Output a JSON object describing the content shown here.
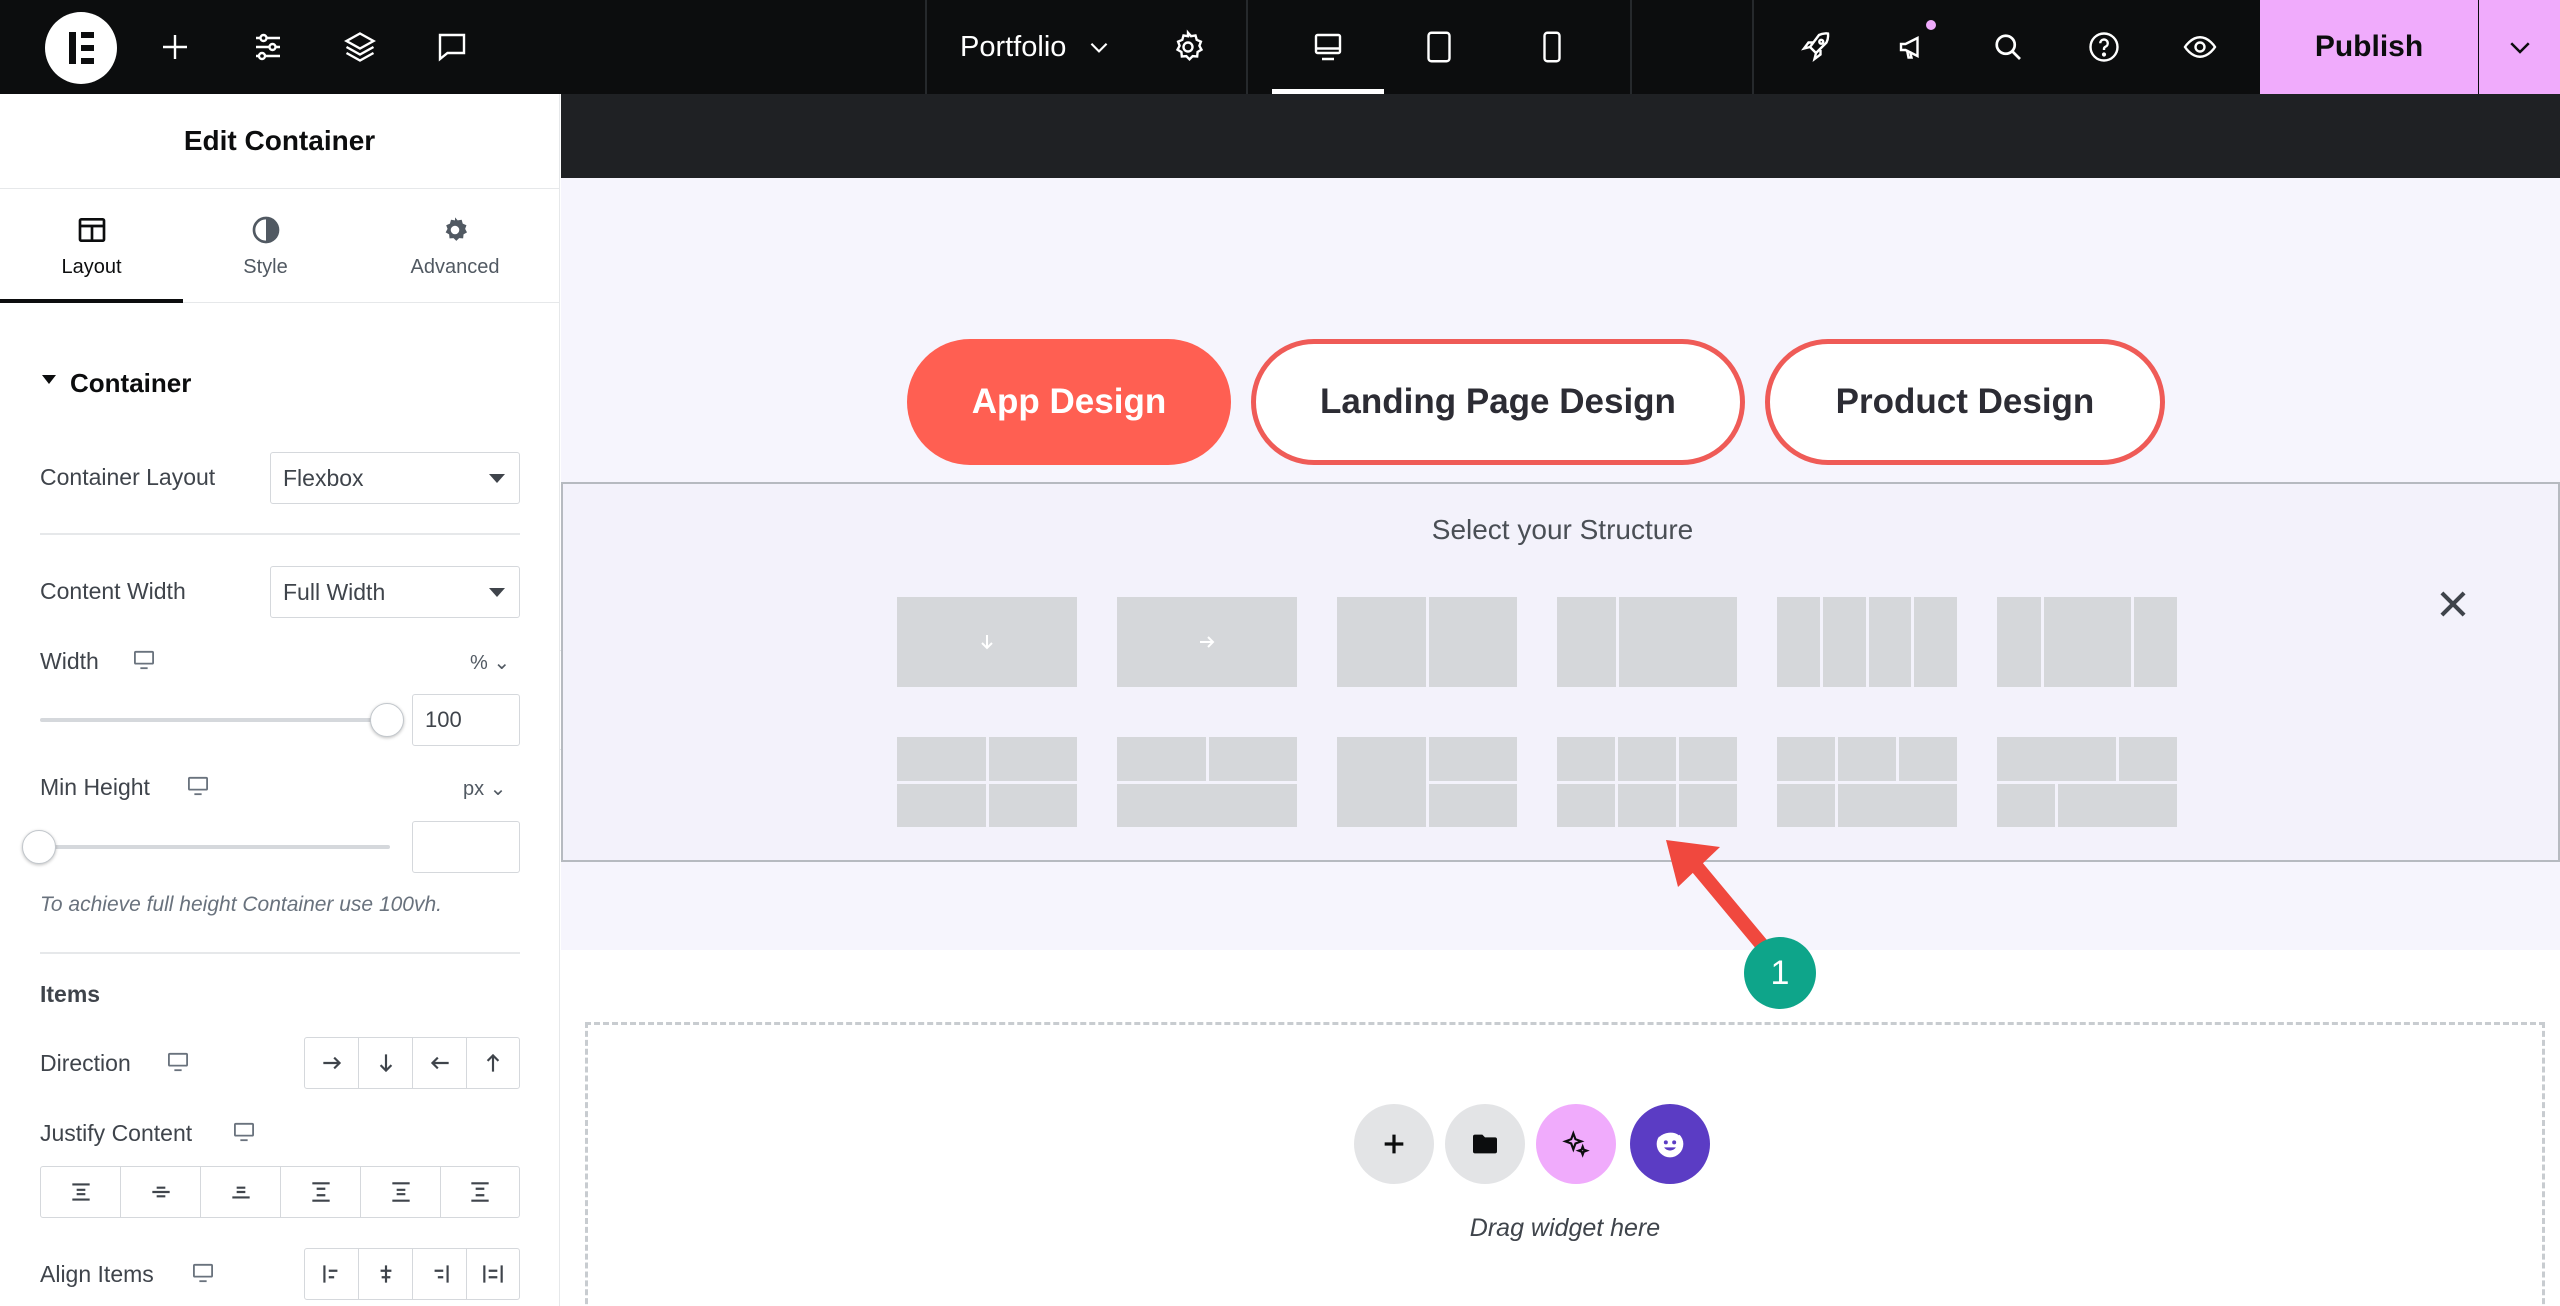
{
  "topbar": {
    "document_title": "Portfolio",
    "publish_label": "Publish"
  },
  "panel": {
    "title": "Edit Container",
    "tabs": [
      {
        "label": "Layout",
        "icon": "layout-icon",
        "active": true
      },
      {
        "label": "Style",
        "icon": "contrast-icon",
        "active": false
      },
      {
        "label": "Advanced",
        "icon": "gear-icon",
        "active": false
      }
    ],
    "section_title": "Container",
    "container_layout": {
      "label": "Container Layout",
      "value": "Flexbox"
    },
    "content_width": {
      "label": "Content Width",
      "value": "Full Width"
    },
    "width": {
      "label": "Width",
      "unit": "%",
      "value": "100",
      "fraction": 1.0
    },
    "min_height": {
      "label": "Min Height",
      "unit": "px",
      "value": "",
      "fraction": 0.0
    },
    "min_height_hint": "To achieve full height Container use 100vh.",
    "items_title": "Items",
    "direction_label": "Direction",
    "justify_label": "Justify Content",
    "align_label": "Align Items"
  },
  "canvas": {
    "pills": [
      {
        "label": "App Design",
        "style": "filled"
      },
      {
        "label": "Landing Page Design",
        "style": "outline"
      },
      {
        "label": "Product Design",
        "style": "outline"
      }
    ],
    "structure_title": "Select your Structure",
    "annotation_number": "1",
    "drop_hint": "Drag widget here"
  },
  "colors": {
    "accent_pink": "#f0abfc",
    "pill_red": "#ff5f52",
    "badge_green": "#0ea58a",
    "arrow_red": "#f0483e",
    "ai_purple": "#5b3cc4"
  }
}
